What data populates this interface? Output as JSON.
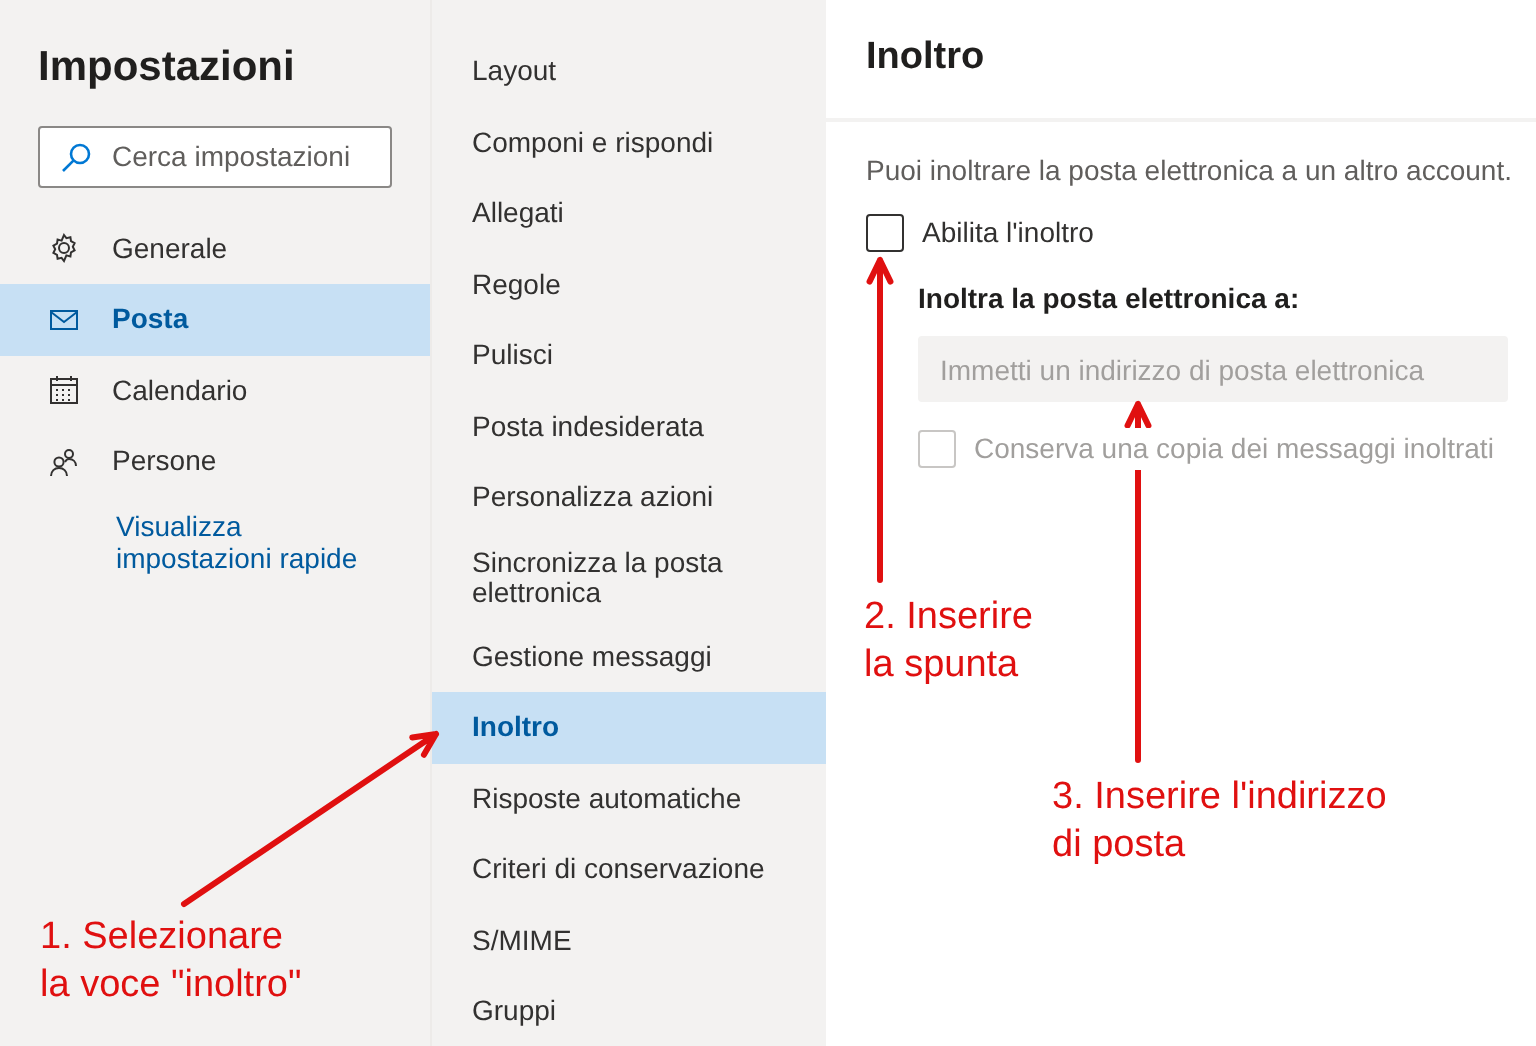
{
  "settings": {
    "title": "Impostazioni",
    "search": {
      "placeholder": "Cerca impostazioni"
    },
    "categories": [
      {
        "label": "Generale",
        "selected": false
      },
      {
        "label": "Posta",
        "selected": true
      },
      {
        "label": "Calendario",
        "selected": false
      },
      {
        "label": "Persone",
        "selected": false
      }
    ],
    "quick_settings_link": "Visualizza impostazioni rapide"
  },
  "mail_menu": {
    "items": [
      {
        "label": "Layout",
        "selected": false
      },
      {
        "label": "Componi e rispondi",
        "selected": false
      },
      {
        "label": "Allegati",
        "selected": false
      },
      {
        "label": "Regole",
        "selected": false
      },
      {
        "label": "Pulisci",
        "selected": false
      },
      {
        "label": "Posta indesiderata",
        "selected": false
      },
      {
        "label": "Personalizza azioni",
        "selected": false
      },
      {
        "label": "Sincronizza la posta elettronica",
        "selected": false
      },
      {
        "label": "Gestione messaggi",
        "selected": false
      },
      {
        "label": "Inoltro",
        "selected": true
      },
      {
        "label": "Risposte automatiche",
        "selected": false
      },
      {
        "label": "Criteri di conservazione",
        "selected": false
      },
      {
        "label": "S/MIME",
        "selected": false
      },
      {
        "label": "Gruppi",
        "selected": false
      }
    ]
  },
  "forwarding": {
    "title": "Inoltro",
    "description": "Puoi inoltrare la posta elettronica a un altro account.",
    "enable": {
      "label": "Abilita l'inoltro",
      "checked": false,
      "disabled": false
    },
    "address": {
      "label": "Inoltra la posta elettronica a:",
      "placeholder": "Immetti un indirizzo di posta elettronica",
      "disabled": true
    },
    "keep_copy": {
      "label": "Conserva una copia dei messaggi inoltrati",
      "checked": false,
      "disabled": true
    }
  },
  "annotations": [
    {
      "text": "1. Selezionare\nla voce \"inoltro\""
    },
    {
      "text": "2. Inserire\nla spunta"
    },
    {
      "text": "3. Inserire l'indirizzo\ndi posta"
    }
  ]
}
